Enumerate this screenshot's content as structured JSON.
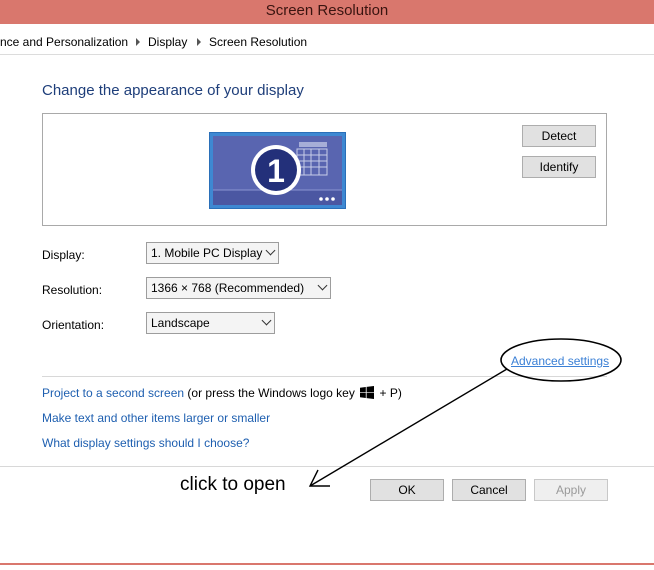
{
  "window": {
    "title": "Screen Resolution"
  },
  "breadcrumb": {
    "items": [
      "nce and Personalization",
      "Display",
      "Screen Resolution"
    ]
  },
  "page": {
    "heading": "Change the appearance of your display"
  },
  "monitor": {
    "number": "1"
  },
  "buttons": {
    "detect": "Detect",
    "identify": "Identify",
    "ok": "OK",
    "cancel": "Cancel",
    "apply": "Apply"
  },
  "fields": {
    "display": {
      "label": "Display:",
      "value": "1. Mobile PC Display"
    },
    "resolution": {
      "label": "Resolution:",
      "value": "1366 × 768 (Recommended)"
    },
    "orientation": {
      "label": "Orientation:",
      "value": "Landscape"
    }
  },
  "links": {
    "advanced": "Advanced settings",
    "project": "Project to a second screen",
    "project_note_before": "(or press the Windows logo key",
    "project_note_after": "+ P)",
    "larger": "Make text and other items larger or smaller",
    "choose": "What display settings should I choose?"
  },
  "annotation": {
    "text": "click to open"
  },
  "colors": {
    "titlebar": "#d9776d",
    "heading": "#1e3e7a",
    "link": "#1e5fb0",
    "monitor": "#4e5aa8"
  }
}
